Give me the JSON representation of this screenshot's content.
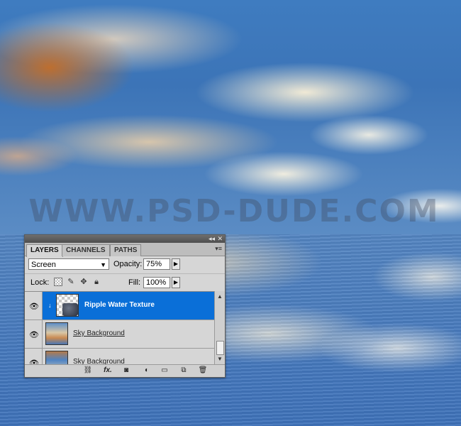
{
  "watermark": "WWW.PSD-DUDE.COM",
  "panel": {
    "titlebar": {
      "collapse_glyph": "◂◂",
      "close_glyph": "✕"
    },
    "tabs": [
      "LAYERS",
      "CHANNELS",
      "PATHS"
    ],
    "menu_glyph": "▾≡",
    "blend_mode": "Screen",
    "opacity_label": "Opacity:",
    "opacity_value": "75%",
    "lock_label": "Lock:",
    "fill_label": "Fill:",
    "fill_value": "100%",
    "layers": [
      {
        "name": "Ripple Water Texture",
        "selected": true,
        "visible": true,
        "smart_object": true
      },
      {
        "name": "Sky Background",
        "selected": false,
        "visible": true
      },
      {
        "name": "Sky Background",
        "selected": false,
        "visible": true
      }
    ],
    "footer_icons": [
      "link-layers-icon",
      "fx-icon",
      "add-mask-icon",
      "adjustment-layer-icon",
      "new-group-icon",
      "new-layer-icon",
      "delete-icon"
    ]
  },
  "colors": {
    "selection": "#0a6fd8",
    "panel_bg": "#d6d6d6"
  }
}
